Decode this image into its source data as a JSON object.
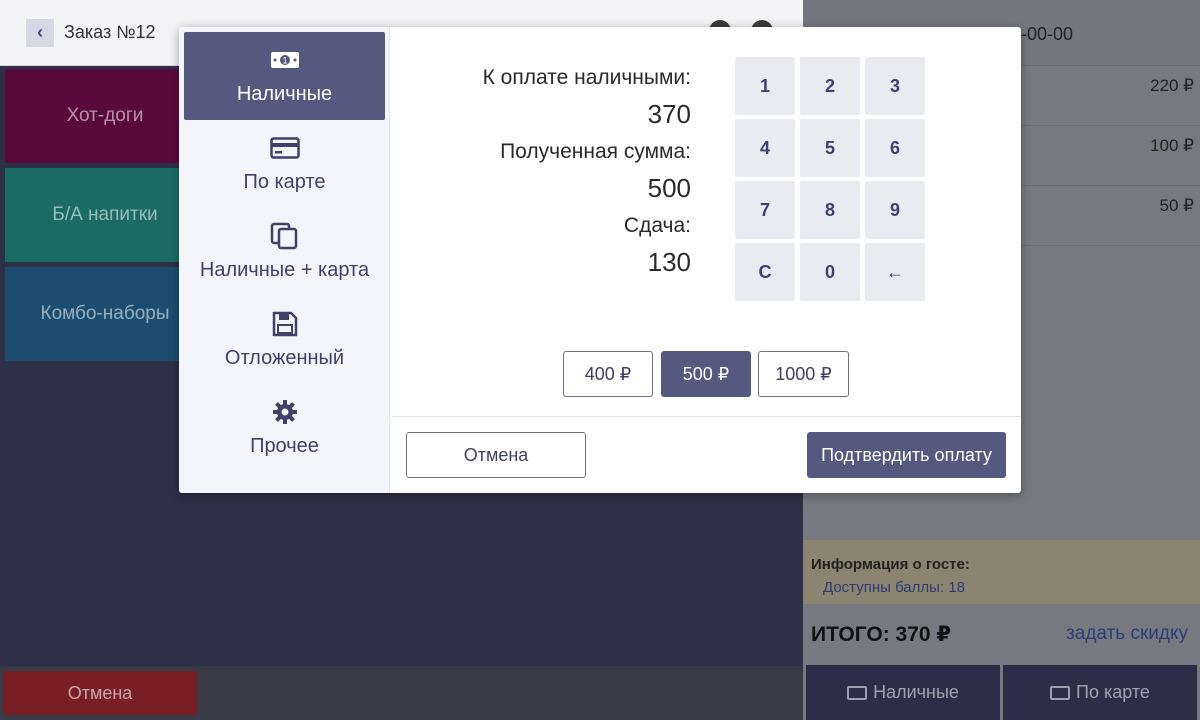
{
  "header": {
    "order_title": "Заказ №12",
    "phone": "-00-00"
  },
  "catalog": {
    "categories": [
      "Хот-доги",
      "Б/А напитки",
      "Комбо-наборы"
    ]
  },
  "footer": {
    "cancel_label": "Отмена"
  },
  "order": {
    "prices": [
      "220 ₽",
      "100 ₽",
      "50 ₽"
    ],
    "guest_title": "Информация о госте:",
    "guest_points": "Доступны баллы: 18",
    "total": "ИТОГО: 370 ₽",
    "discount_link": "задать скидку",
    "pay_cash": "Наличные",
    "pay_card": "По карте"
  },
  "modal": {
    "methods": [
      {
        "label": "Наличные",
        "icon": "cash-icon",
        "active": true
      },
      {
        "label": "По карте",
        "icon": "card-icon",
        "active": false
      },
      {
        "label": "Наличные + карта",
        "icon": "copy-icon",
        "active": false
      },
      {
        "label": "Отложенный",
        "icon": "save-icon",
        "active": false
      },
      {
        "label": "Прочее",
        "icon": "gear-icon",
        "active": false
      }
    ],
    "due_label": "К оплате наличными:",
    "due_value": "370",
    "received_label": "Полученная сумма:",
    "received_value": "500",
    "change_label": "Сдача:",
    "change_value": "130",
    "keypad": [
      "1",
      "2",
      "3",
      "4",
      "5",
      "6",
      "7",
      "8",
      "9",
      "C",
      "0",
      "←"
    ],
    "quick_amounts": [
      "400 ₽",
      "500 ₽",
      "1000 ₽"
    ],
    "quick_selected": "500 ₽",
    "cancel_label": "Отмена",
    "confirm_label": "Подтвердить оплату"
  },
  "colors": {
    "accent": "#55587f",
    "key_bg": "#e9ebf1",
    "sidebar_bg": "#f3f5fa"
  }
}
